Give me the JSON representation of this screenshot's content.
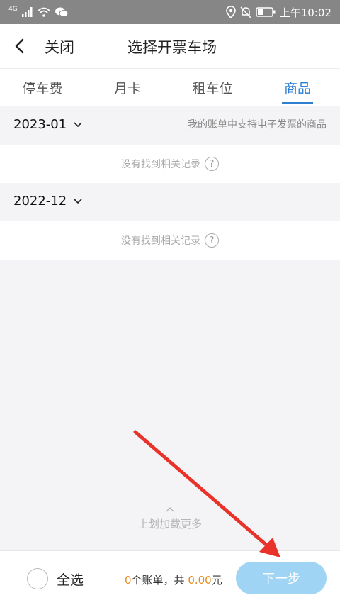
{
  "status_bar": {
    "network": "4G",
    "time": "上午10:02"
  },
  "nav": {
    "close_label": "关闭",
    "title": "选择开票车场"
  },
  "tabs": [
    {
      "label": "停车费",
      "active": false
    },
    {
      "label": "月卡",
      "active": false
    },
    {
      "label": "租车位",
      "active": false
    },
    {
      "label": "商品",
      "active": true
    }
  ],
  "months": [
    {
      "label": "2023-01",
      "note": "我的账单中支持电子发票的商品",
      "empty_text": "没有找到相关记录"
    },
    {
      "label": "2022-12",
      "note": "",
      "empty_text": "没有找到相关记录"
    }
  ],
  "load_more": "上划加载更多",
  "bottom": {
    "select_all": "全选",
    "count": "0",
    "count_suffix": "个账单，共 ",
    "amount": "0.00",
    "amount_suffix": "元",
    "next_label": "下一步"
  },
  "colors": {
    "accent": "#2f7fd0",
    "amount": "#e58a1a",
    "next_button": "#9fd4f4",
    "annotation_arrow": "#e8322a"
  },
  "icons": {
    "back": "chevron-left-icon",
    "dropdown": "chevron-down-icon",
    "help": "question-circle-icon",
    "load_more": "chevron-up-icon"
  }
}
